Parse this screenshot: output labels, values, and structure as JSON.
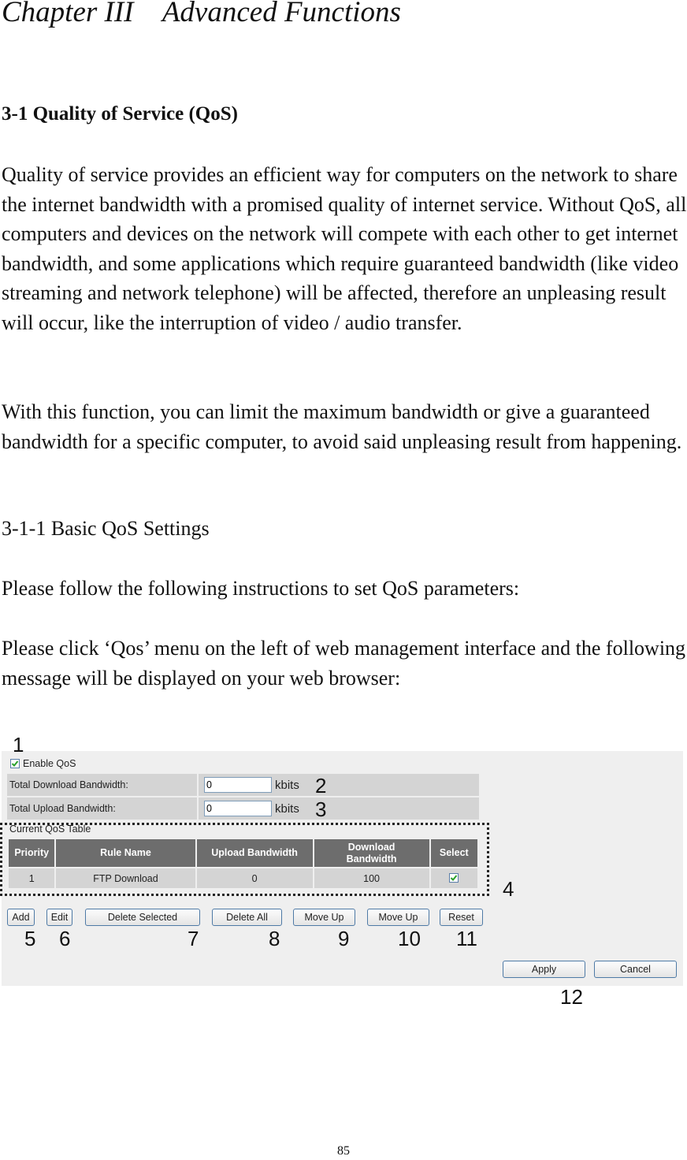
{
  "chapter_title": "Chapter III    Advanced Functions",
  "section_title": "3-1 Quality of Service (QoS)",
  "paragraphs": {
    "intro_1": "Quality of service provides an efficient way for computers on the network to share the internet bandwidth with a promised quality of internet service. Without QoS, all computers and devices on the network will compete with each other to get internet bandwidth, and some applications which require guaranteed bandwidth (like video streaming and network telephone) will be affected, therefore an unpleasing result will occur, like the interruption of video / audio transfer.",
    "intro_2": "With this function, you can limit the maximum bandwidth or give a guaranteed bandwidth for a specific computer, to avoid said unpleasing result from happening.",
    "subsection": "3-1-1 Basic QoS Settings",
    "instruction": "Please follow the following instructions to set QoS parameters:",
    "click_note": "Please click ‘Qos’ menu on the left of web management interface and the following message will be displayed on your web browser:"
  },
  "ui": {
    "enable_qos": {
      "label": "Enable QoS",
      "checked": true
    },
    "download_bw": {
      "label": "Total Download Bandwidth:",
      "value": "0",
      "unit": "kbits"
    },
    "upload_bw": {
      "label": "Total Upload Bandwidth:",
      "value": "0",
      "unit": "kbits"
    },
    "table_title": "Current QoS Table",
    "columns": [
      "Priority",
      "Rule Name",
      "Upload Bandwidth",
      "Download Bandwidth",
      "Select"
    ],
    "rows": [
      {
        "priority": "1",
        "rule_name": "FTP Download",
        "upload": "0",
        "download": "100",
        "selected": true
      }
    ],
    "buttons": {
      "add": "Add",
      "edit": "Edit",
      "delete_selected": "Delete Selected",
      "delete_all": "Delete All",
      "move_up": "Move Up",
      "move_down": "Move Up",
      "reset": "Reset",
      "apply": "Apply",
      "cancel": "Cancel"
    }
  },
  "annotations": [
    "1",
    "2",
    "3",
    "4",
    "5",
    "6",
    "7",
    "8",
    "9",
    "10",
    "11",
    "12"
  ],
  "page_number": "85",
  "colors": {
    "header_bg": "#6d6d6d",
    "row_bg": "#d4d4d4",
    "panel_bg": "#efefef",
    "button_border": "#4e7aa6",
    "check_green": "#2aa02a"
  }
}
